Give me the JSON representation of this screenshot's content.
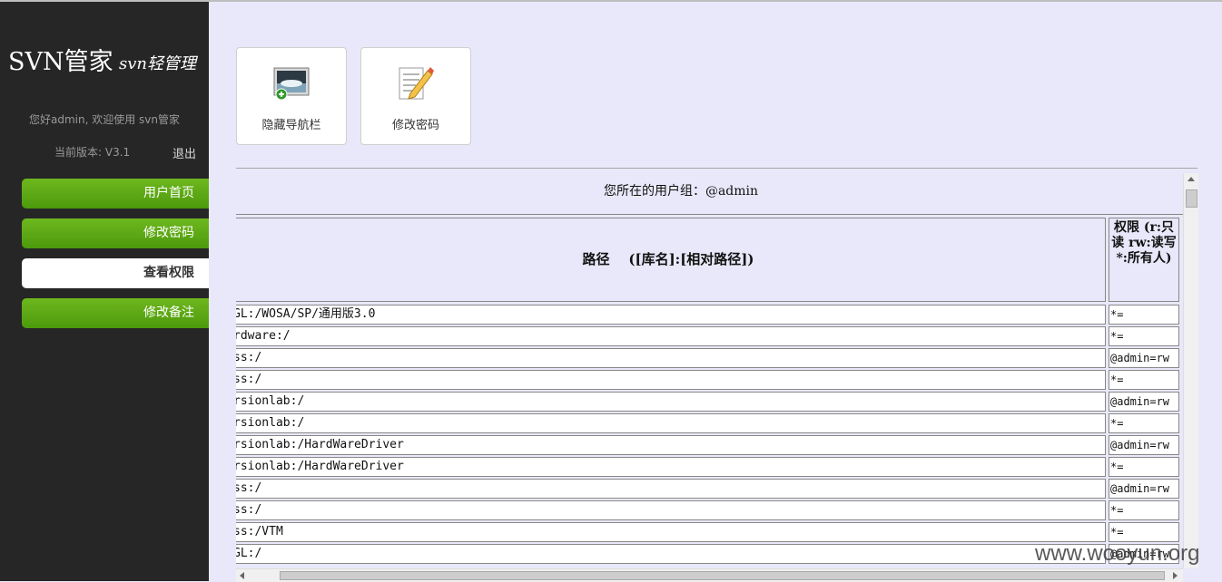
{
  "sidebar": {
    "logo": "SVN管家",
    "logo_sub": "svn轻管理",
    "welcome": "您好admin, 欢迎使用 svn管家",
    "version": "当前版本: V3.1",
    "logout": "退出",
    "nav": [
      {
        "label": "用户首页"
      },
      {
        "label": "修改密码"
      },
      {
        "label": "查看权限"
      },
      {
        "label": "修改备注"
      }
    ]
  },
  "toolbar": {
    "hide_nav_label": "隐藏导航栏",
    "change_password_label": "修改密码"
  },
  "content": {
    "group_text": "您所在的用户组：@admin",
    "header_path": "路径    ([库名]:[相对路径])",
    "header_perm": "权限 (r:只读 rw:读写 *:所有人)",
    "rows": [
      {
        "path": "GL:/WOSA/SP/通用版3.0",
        "perm": "*="
      },
      {
        "path": "rdware:/",
        "perm": "*="
      },
      {
        "path": "ss:/",
        "perm": "@admin=rw"
      },
      {
        "path": "ss:/",
        "perm": "*="
      },
      {
        "path": "rsionlab:/",
        "perm": "@admin=rw"
      },
      {
        "path": "rsionlab:/",
        "perm": "*="
      },
      {
        "path": "rsionlab:/HardWareDriver",
        "perm": "@admin=rw"
      },
      {
        "path": "rsionlab:/HardWareDriver",
        "perm": "*="
      },
      {
        "path": "ss:/",
        "perm": "@admin=rw"
      },
      {
        "path": "ss:/",
        "perm": "*="
      },
      {
        "path": "ss:/VTM",
        "perm": "*="
      },
      {
        "path": "GL:/",
        "perm": "@admin=rw"
      }
    ]
  },
  "watermark": "www.wooyun.org"
}
